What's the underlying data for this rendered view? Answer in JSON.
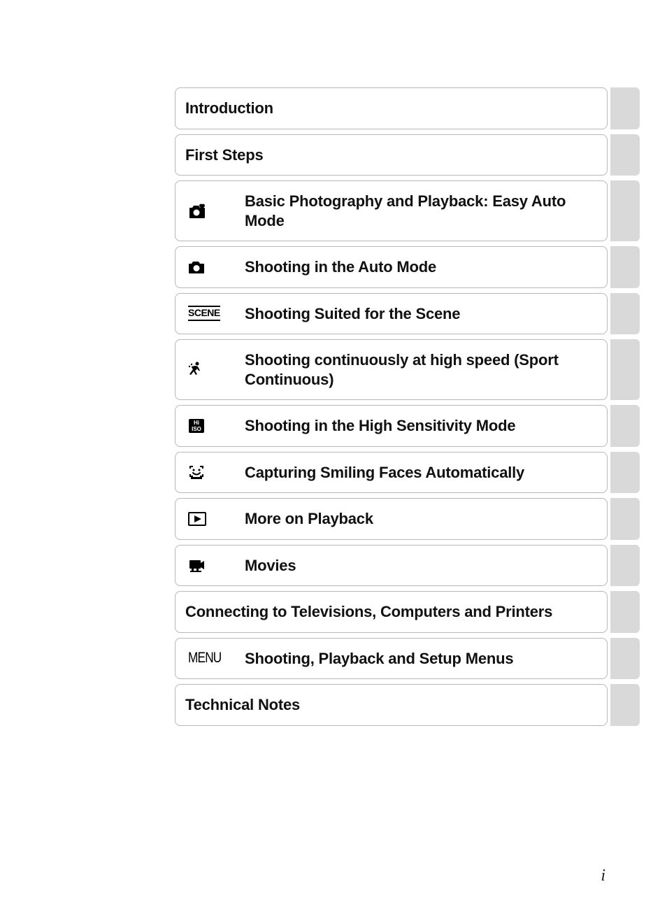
{
  "page_number": "i",
  "toc": [
    {
      "label": "Introduction",
      "icon": null
    },
    {
      "label": "First Steps",
      "icon": null
    },
    {
      "label": "Basic Photography and Playback: Easy Auto Mode",
      "icon": "easy-auto-icon"
    },
    {
      "label": "Shooting in the Auto Mode",
      "icon": "auto-icon"
    },
    {
      "label": "Shooting Suited for the Scene",
      "icon": "scene-icon"
    },
    {
      "label": "Shooting continuously at high speed (Sport Continuous)",
      "icon": "sport-icon"
    },
    {
      "label": "Shooting in the High Sensitivity Mode",
      "icon": "hi-iso-icon"
    },
    {
      "label": "Capturing Smiling Faces Automatically",
      "icon": "smile-icon"
    },
    {
      "label": "More on Playback",
      "icon": "playback-icon"
    },
    {
      "label": "Movies",
      "icon": "movie-icon"
    },
    {
      "label": "Connecting to Televisions, Computers and Printers",
      "icon": null
    },
    {
      "label": "Shooting, Playback and Setup Menus",
      "icon": "menu-icon"
    },
    {
      "label": "Technical Notes",
      "icon": null
    }
  ]
}
